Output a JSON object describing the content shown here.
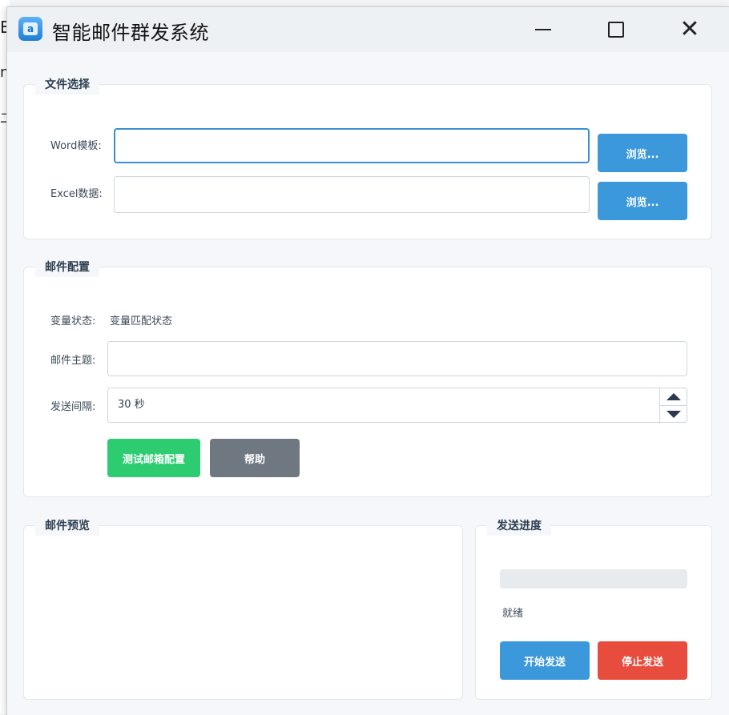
{
  "window": {
    "title": "智能邮件群发系统",
    "icon": "app-mail-icon",
    "controls": [
      "minimize-icon",
      "maximize-icon",
      "close-icon"
    ]
  },
  "background_fragments": [
    "E",
    "n",
    "二"
  ],
  "file_selection": {
    "legend": "文件选择",
    "word_label": "Word模板:",
    "word_value": "",
    "excel_label": "Excel数据:",
    "excel_value": "",
    "browse_word_label": "浏览...",
    "browse_excel_label": "浏览..."
  },
  "email_config": {
    "legend": "邮件配置",
    "var_status_label": "变量状态:",
    "var_status_value": "变量匹配状态",
    "subject_label": "邮件主题:",
    "subject_value": "",
    "interval_label": "发送间隔:",
    "interval_value": "30 秒",
    "test_button": "测试邮箱配置",
    "help_button": "帮助"
  },
  "preview": {
    "legend": "邮件预览"
  },
  "progress": {
    "legend": "发送进度",
    "fraction": 0,
    "status": "就绪",
    "start_button": "开始发送",
    "stop_button": "停止发送"
  },
  "colors": {
    "primary": "#3a98db",
    "success": "#2ecc71",
    "neutral": "#6f7780",
    "danger": "#e74c3c"
  }
}
